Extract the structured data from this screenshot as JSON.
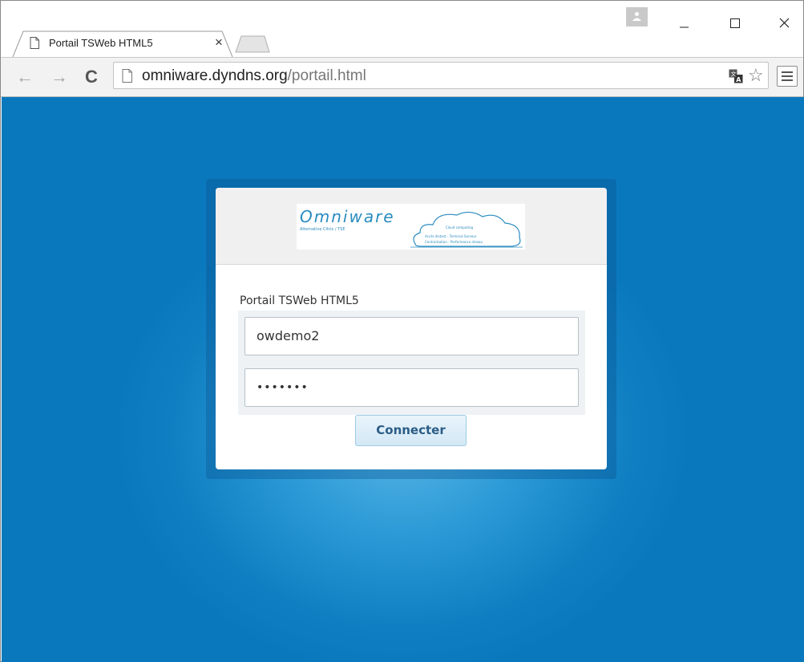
{
  "browser": {
    "tab": {
      "title": "Portail TSWeb HTML5",
      "close_glyph": "×",
      "icon": "page-icon"
    },
    "window_controls": {
      "minimize": "–",
      "maximize": "☐",
      "close": "✕"
    },
    "toolbar": {
      "back_glyph": "←",
      "forward_glyph": "→",
      "reload_glyph": "C",
      "url_host": "omniware.dyndns.org",
      "url_path": "/portail.html",
      "star_glyph": "☆"
    }
  },
  "page": {
    "logo": {
      "brand": "Omniware",
      "tagline": "Alternative Citrix / TSE",
      "cloud_line1": "Cloud computing",
      "cloud_line2": "Accès distant - Terminal Serveur",
      "cloud_line3": "Centralisation - Performance réseau"
    },
    "title": "Portail TSWeb HTML5",
    "username_value": "owdemo2",
    "password_masked": "•••••••",
    "connect_label": "Connecter"
  },
  "colors": {
    "background_blue": "#0a78bd",
    "accent": "#2a8bbf",
    "button_text": "#2b5d86"
  }
}
